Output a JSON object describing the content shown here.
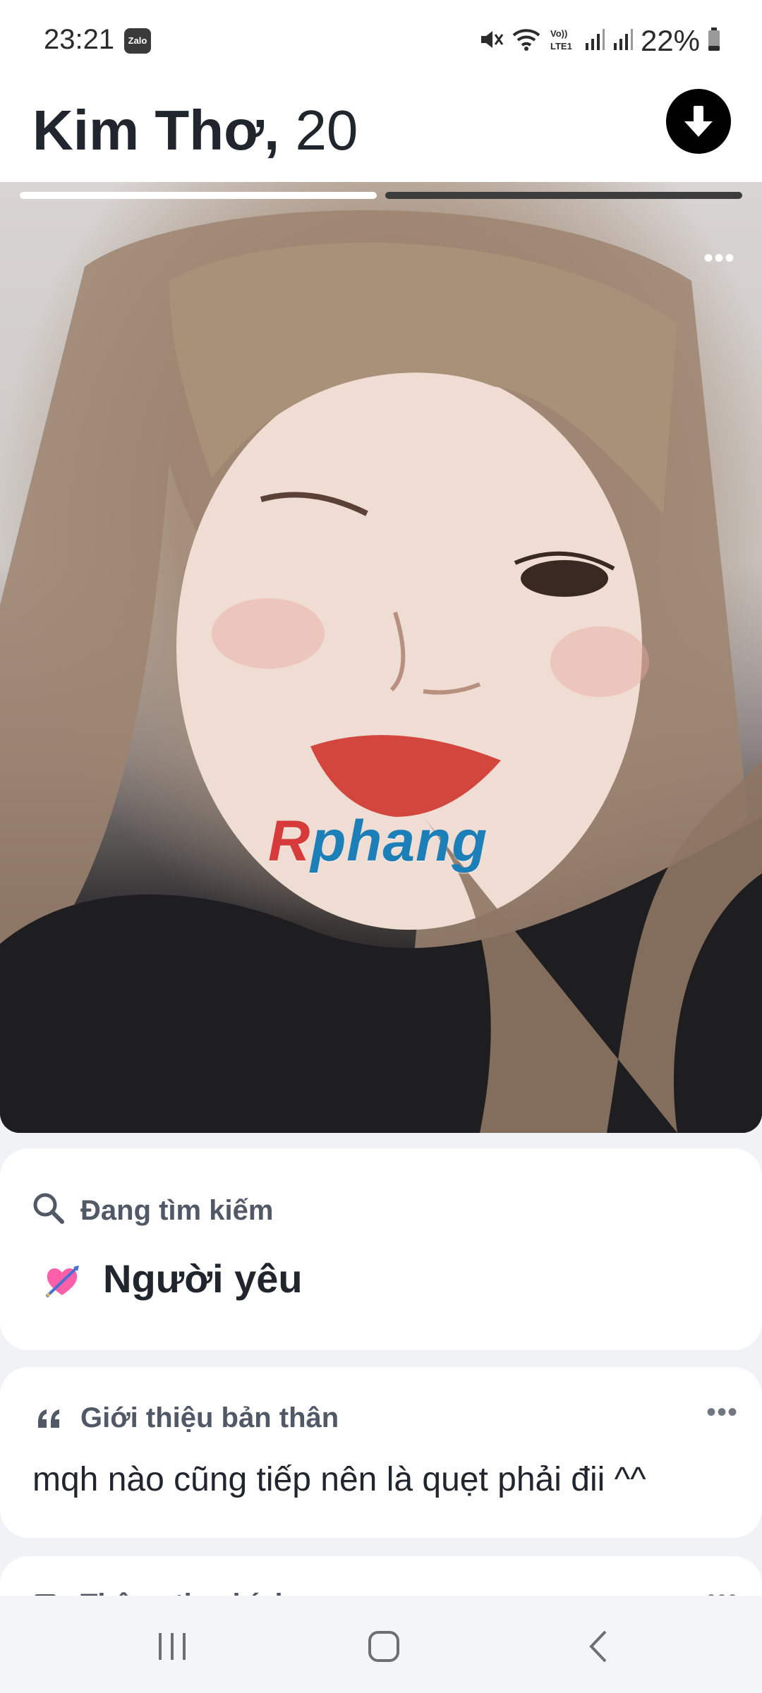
{
  "status_bar": {
    "time": "23:21",
    "notification_app": "Zalo",
    "network_label": "VoLTE1",
    "battery_percent": "22%",
    "icons": [
      "mute-icon",
      "wifi-icon",
      "volte-icon",
      "signal-icon",
      "signal-icon",
      "battery-icon"
    ]
  },
  "header": {
    "name": "Kim Thơ,",
    "age": "20",
    "collapse_icon": "arrow-down-icon"
  },
  "photo": {
    "photo_index": 1,
    "photo_count": 2,
    "watermark": {
      "first_letter": "R",
      "rest": "phang"
    },
    "more_icon": "more-horizontal-icon"
  },
  "looking_for": {
    "label": "Đang tìm kiếm",
    "icon": "search-icon",
    "emoji_icon": "heart-with-arrow-icon",
    "value": "Người yêu"
  },
  "bio": {
    "label": "Giới thiệu bản thân",
    "icon": "quote-icon",
    "text": "mqh nào cũng tiếp nên là quẹt phải đii ^^"
  },
  "next_section": {
    "label": "Thông tin chính",
    "icon": "id-card-icon"
  },
  "nav_bar": {
    "buttons": [
      "recents-icon",
      "home-icon",
      "back-icon"
    ]
  },
  "colors": {
    "accent_dark": "#000000",
    "text_primary": "#21262e",
    "text_secondary": "#505965",
    "card_bg": "#ffffff",
    "page_bg": "#f0f2f5"
  }
}
